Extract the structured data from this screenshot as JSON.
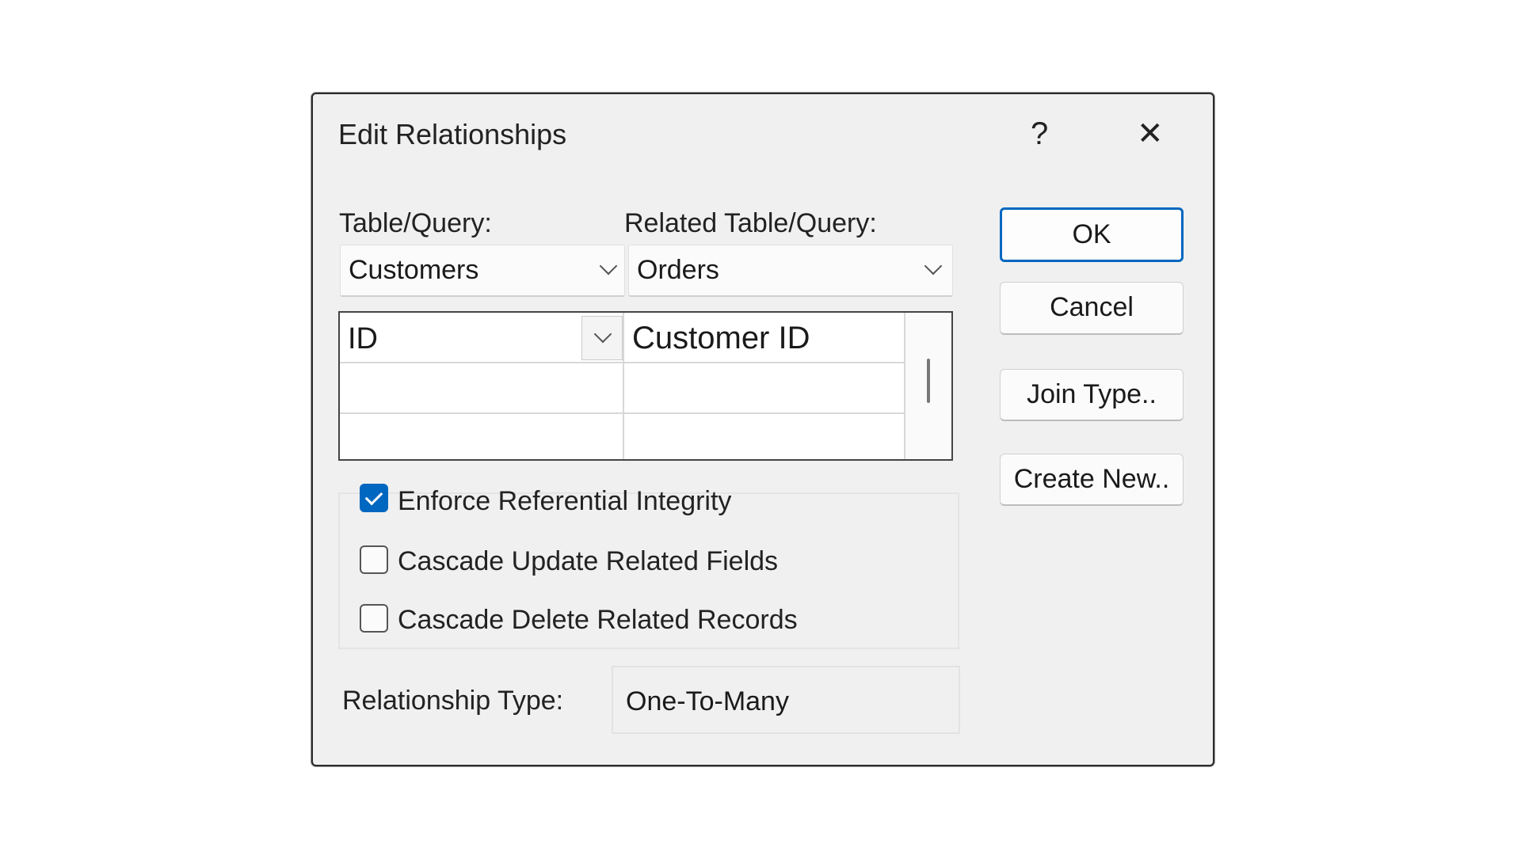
{
  "dialog": {
    "title": "Edit Relationships",
    "help_label": "?",
    "close_label": "✕"
  },
  "table_query": {
    "label": "Table/Query:",
    "value": "Customers"
  },
  "related_table_query": {
    "label": "Related Table/Query:",
    "value": "Orders"
  },
  "field_grid": {
    "rows": [
      {
        "field": "ID",
        "related_field": "Customer ID"
      },
      {
        "field": "",
        "related_field": ""
      },
      {
        "field": "",
        "related_field": ""
      }
    ]
  },
  "buttons": {
    "ok": "OK",
    "cancel": "Cancel",
    "join_type": "Join Type..",
    "create_new": "Create New.."
  },
  "options": [
    {
      "label": "Enforce Referential Integrity",
      "checked": true
    },
    {
      "label": "Cascade Update Related Fields",
      "checked": false
    },
    {
      "label": "Cascade Delete Related Records",
      "checked": false
    }
  ],
  "relationship_type": {
    "label": "Relationship Type:",
    "value": "One-To-Many"
  },
  "colors": {
    "accent": "#0067c0",
    "dialog_bg": "#f0f0f0"
  }
}
